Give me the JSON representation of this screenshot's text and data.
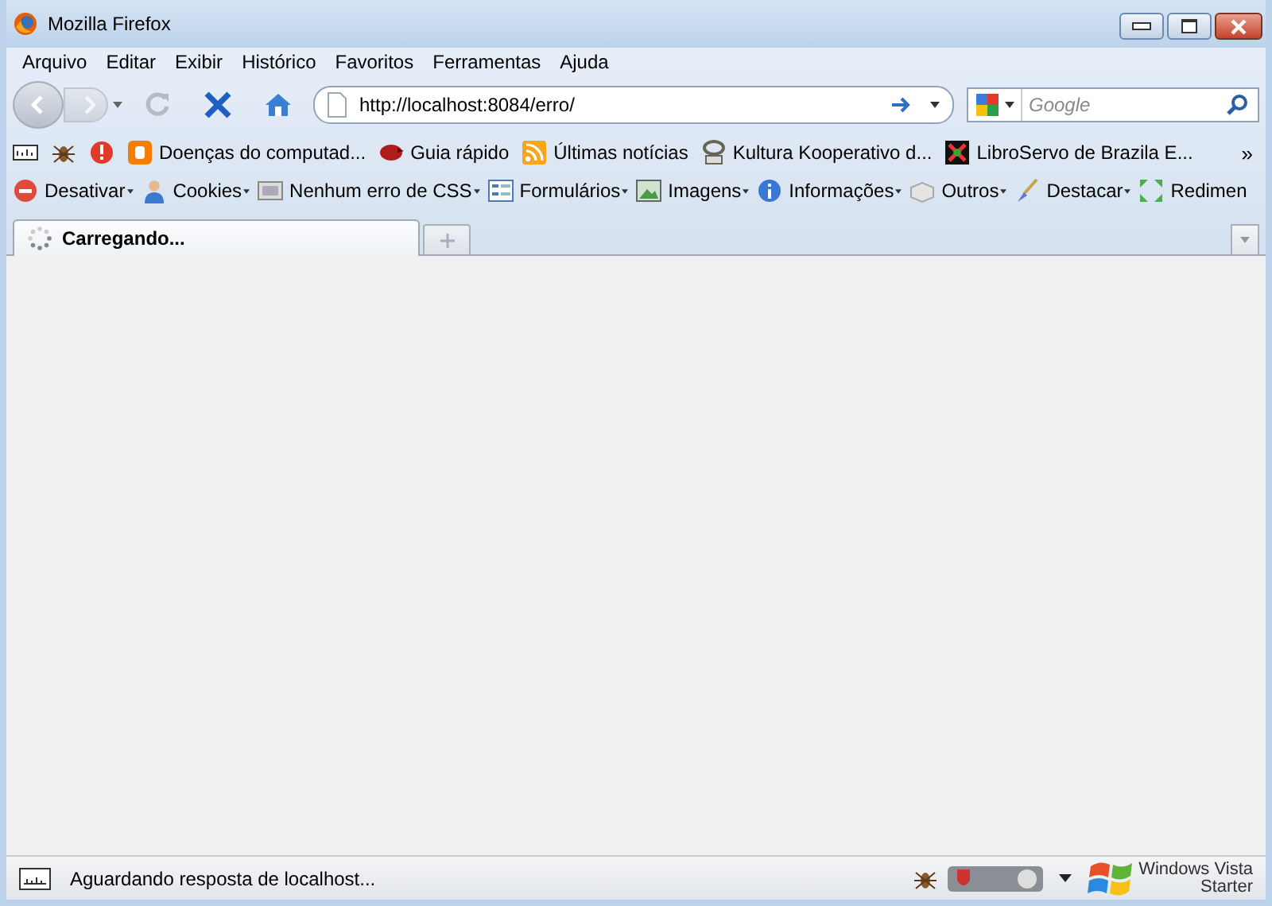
{
  "window": {
    "title": "Mozilla Firefox"
  },
  "menu": [
    {
      "label": "Arquivo"
    },
    {
      "label": "Editar"
    },
    {
      "label": "Exibir"
    },
    {
      "label": "Histórico"
    },
    {
      "label": "Favoritos"
    },
    {
      "label": "Ferramentas"
    },
    {
      "label": "Ajuda"
    }
  ],
  "navigation": {
    "back_disabled": false,
    "forward_disabled": true,
    "reload_disabled": true,
    "url": "http://localhost:8084/erro/",
    "search": {
      "placeholder": "Google"
    }
  },
  "bookmarks": [
    {
      "label": "Doenças do computad..."
    },
    {
      "label": "Guia rápido"
    },
    {
      "label": "Últimas notícias"
    },
    {
      "label": "Kultura Kooperativo d..."
    },
    {
      "label": "LibroServo de Brazila E..."
    }
  ],
  "bookmarks_overflow": "»",
  "developer_toolbar": [
    {
      "label": "Desativar",
      "has_menu": true
    },
    {
      "label": "Cookies",
      "has_menu": true
    },
    {
      "label": "Nenhum erro de CSS",
      "has_menu": true
    },
    {
      "label": "Formulários",
      "has_menu": true
    },
    {
      "label": "Imagens",
      "has_menu": true
    },
    {
      "label": "Informações",
      "has_menu": true
    },
    {
      "label": "Outros",
      "has_menu": true
    },
    {
      "label": "Destacar",
      "has_menu": true
    },
    {
      "label": "Redimen",
      "has_menu": false
    }
  ],
  "tabs": [
    {
      "label": "Carregando...",
      "selected": true,
      "loading": true
    }
  ],
  "status_bar": {
    "text": "Aguardando resposta de localhost..."
  },
  "os_watermark": [
    "Windows Vista",
    "Starter"
  ]
}
